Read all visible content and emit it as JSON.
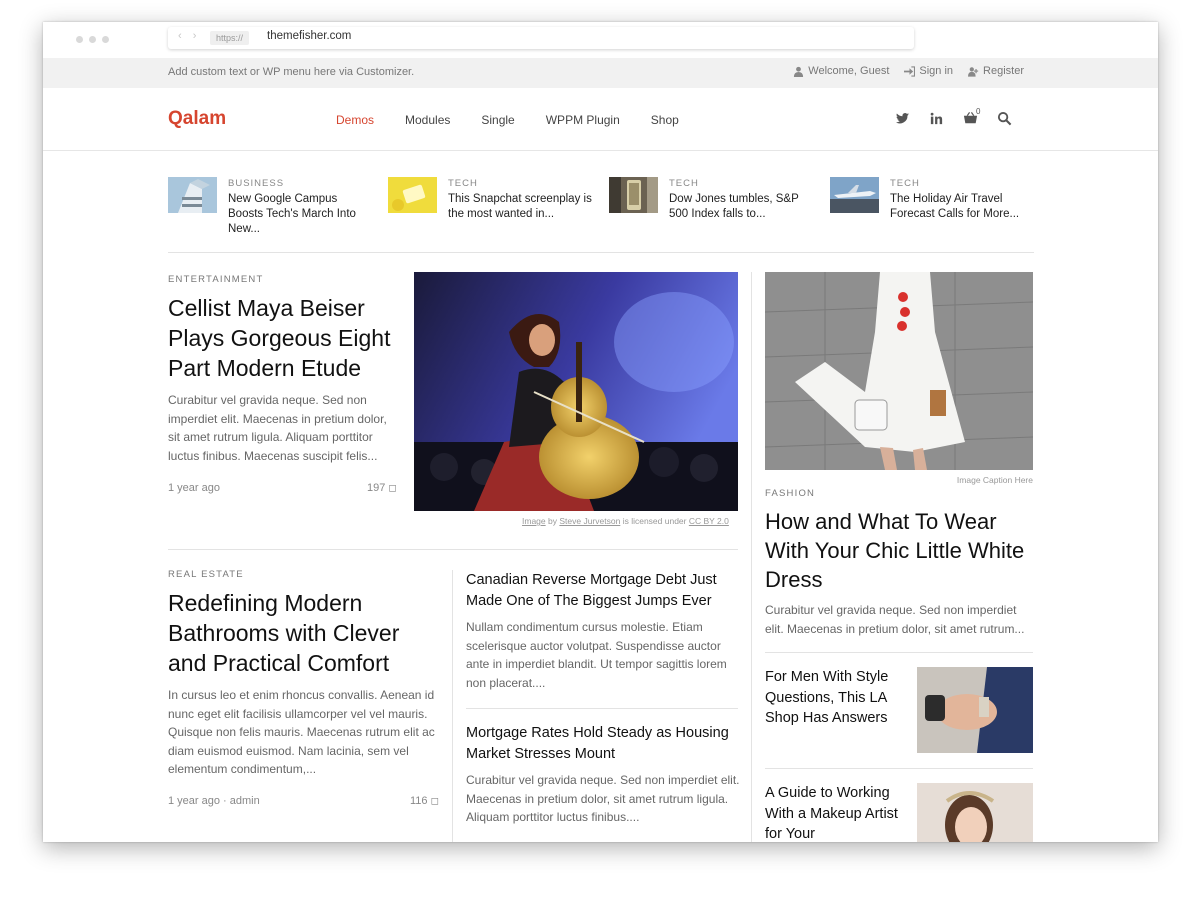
{
  "browser": {
    "protocol": "https://",
    "url": "themefisher.com"
  },
  "topbar": {
    "custom_text": "Add custom text or WP menu here via Customizer.",
    "welcome": "Welcome, Guest",
    "signin": "Sign in",
    "register": "Register"
  },
  "header": {
    "logo": "Qalam",
    "menu": [
      {
        "label": "Demos",
        "active": true
      },
      {
        "label": "Modules"
      },
      {
        "label": "Single"
      },
      {
        "label": "WPPM Plugin"
      },
      {
        "label": "Shop"
      }
    ],
    "cart_count": "0",
    "icons": [
      "twitter-icon",
      "linkedin-icon",
      "cart-icon",
      "search-icon"
    ]
  },
  "ticker": [
    {
      "category": "BUSINESS",
      "title": "New Google Campus Boosts Tech's March Into New..."
    },
    {
      "category": "TECH",
      "title": "This Snapchat screenplay is the most wanted in..."
    },
    {
      "category": "TECH",
      "title": "Dow Jones tumbles, S&P 500 Index falls to..."
    },
    {
      "category": "TECH",
      "title": "The Holiday Air Travel Forecast Calls for More..."
    }
  ],
  "featured": {
    "category": "ENTERTAINMENT",
    "title": "Cellist Maya Beiser Plays Gorgeous Eight Part Modern Etude",
    "excerpt": "Curabitur vel gravida neque. Sed non imperdiet elit. Maecenas in pretium dolor, sit amet rutrum ligula. Aliquam porttitor luctus finibus. Maecenas suscipit felis...",
    "date": "1 year ago",
    "comments": "197",
    "caption": {
      "image": "Image",
      "by": "by",
      "author": "Steve Jurvetson",
      "licensed": "is licensed under",
      "license": "CC BY 2.0"
    }
  },
  "real_estate": {
    "category": "REAL ESTATE",
    "title": "Redefining Modern Bathrooms with Clever and Practical Comfort",
    "excerpt": "In cursus leo et enim rhoncus convallis. Aenean id nunc eget elit facilisis ullamcorper vel vel mauris. Quisque non felis mauris. Maecenas rutrum elit ac diam euismod euismod. Nam lacinia, sem vel elementum condimentum,...",
    "date": "1 year ago",
    "author": "admin",
    "comments": "116"
  },
  "mid_posts": [
    {
      "title": "Canadian Reverse Mortgage Debt Just Made One of The Biggest Jumps Ever",
      "excerpt": "Nullam condimentum cursus molestie. Etiam scelerisque auctor volutpat. Suspendisse auctor ante in imperdiet blandit. Ut tempor sagittis lorem non placerat...."
    },
    {
      "title": "Mortgage Rates Hold Steady as Housing Market Stresses Mount",
      "excerpt": "Curabitur vel gravida neque. Sed non imperdiet elit. Maecenas in pretium dolor, sit amet rutrum ligula. Aliquam porttitor luctus finibus...."
    }
  ],
  "fashion": {
    "caption": "Image Caption Here",
    "category": "FASHION",
    "title": "How and What To Wear With Your Chic Little White Dress",
    "excerpt": "Curabitur vel gravida neque. Sed non imperdiet elit. Maecenas in pretium dolor, sit amet rutrum..."
  },
  "side_posts": [
    {
      "title": "For Men With Style Questions, This LA Shop Has Answers"
    },
    {
      "title": "A Guide to Working With a Makeup Artist for Your"
    }
  ],
  "colors": {
    "accent": "#d6452f"
  }
}
